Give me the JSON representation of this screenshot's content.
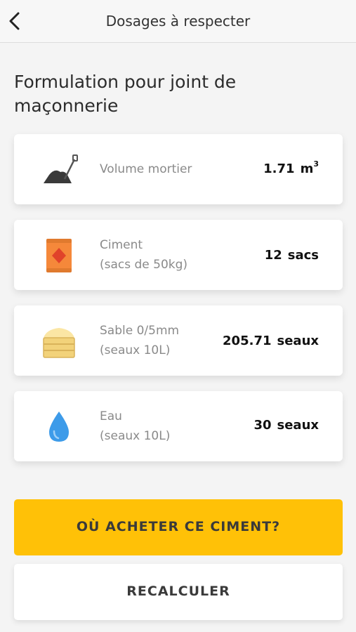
{
  "header": {
    "title": "Dosages à respecter",
    "back_icon": "chevron-left-icon"
  },
  "section": {
    "title": "Formulation pour joint de maçonnerie"
  },
  "items": [
    {
      "icon": "mortar-shovel-icon",
      "label": "Volume mortier",
      "sublabel": "",
      "value": "1.71",
      "unit": "m",
      "unit_sup": "3"
    },
    {
      "icon": "cement-bag-icon",
      "label": "Ciment",
      "sublabel": "(sacs de 50kg)",
      "value": "12",
      "unit": "sacs"
    },
    {
      "icon": "sand-bucket-icon",
      "label": "Sable 0/5mm",
      "sublabel": "(seaux 10L)",
      "value": "205.71",
      "unit": "seaux"
    },
    {
      "icon": "water-drop-icon",
      "label": "Eau",
      "sublabel": "(seaux 10L)",
      "value": "30",
      "unit": "seaux"
    }
  ],
  "buttons": {
    "buy": "OÙ ACHETER CE CIMENT?",
    "recalc": "RECALCULER"
  },
  "colors": {
    "accent": "#ffc107",
    "cement_orange": "#f5883a",
    "sand": "#f2d27a",
    "water": "#3d9be9"
  }
}
